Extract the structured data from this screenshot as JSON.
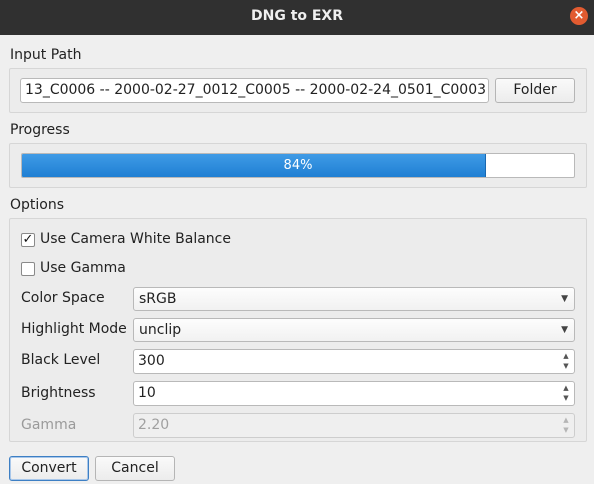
{
  "window": {
    "title": "DNG to EXR",
    "close_glyph": "×"
  },
  "input_path": {
    "section_label": "Input Path",
    "value": "13_C0006  --  2000-02-27_0012_C0005  --  2000-02-24_0501_C0003",
    "folder_button": "Folder"
  },
  "progress": {
    "section_label": "Progress",
    "value_percent": 84,
    "text": "84%"
  },
  "options": {
    "section_label": "Options",
    "use_camera_white_balance": {
      "label": "Use Camera White Balance",
      "checked": true
    },
    "use_gamma": {
      "label": "Use Gamma",
      "checked": false
    },
    "color_space": {
      "label": "Color Space",
      "value": "sRGB"
    },
    "highlight_mode": {
      "label": "Highlight Mode",
      "value": "unclip"
    },
    "black_level": {
      "label": "Black Level",
      "value": "300"
    },
    "brightness": {
      "label": "Brightness",
      "value": "10"
    },
    "gamma": {
      "label": "Gamma",
      "value": "2.20",
      "disabled": true
    }
  },
  "buttons": {
    "convert": "Convert",
    "cancel": "Cancel"
  },
  "glyphs": {
    "checkmark": "✓",
    "dropdown": "▼",
    "spin_up": "▲",
    "spin_down": "▼"
  },
  "colors": {
    "progress_fill": "#2a8ad8",
    "titlebar": "#303030",
    "close_button": "#e25b30"
  }
}
